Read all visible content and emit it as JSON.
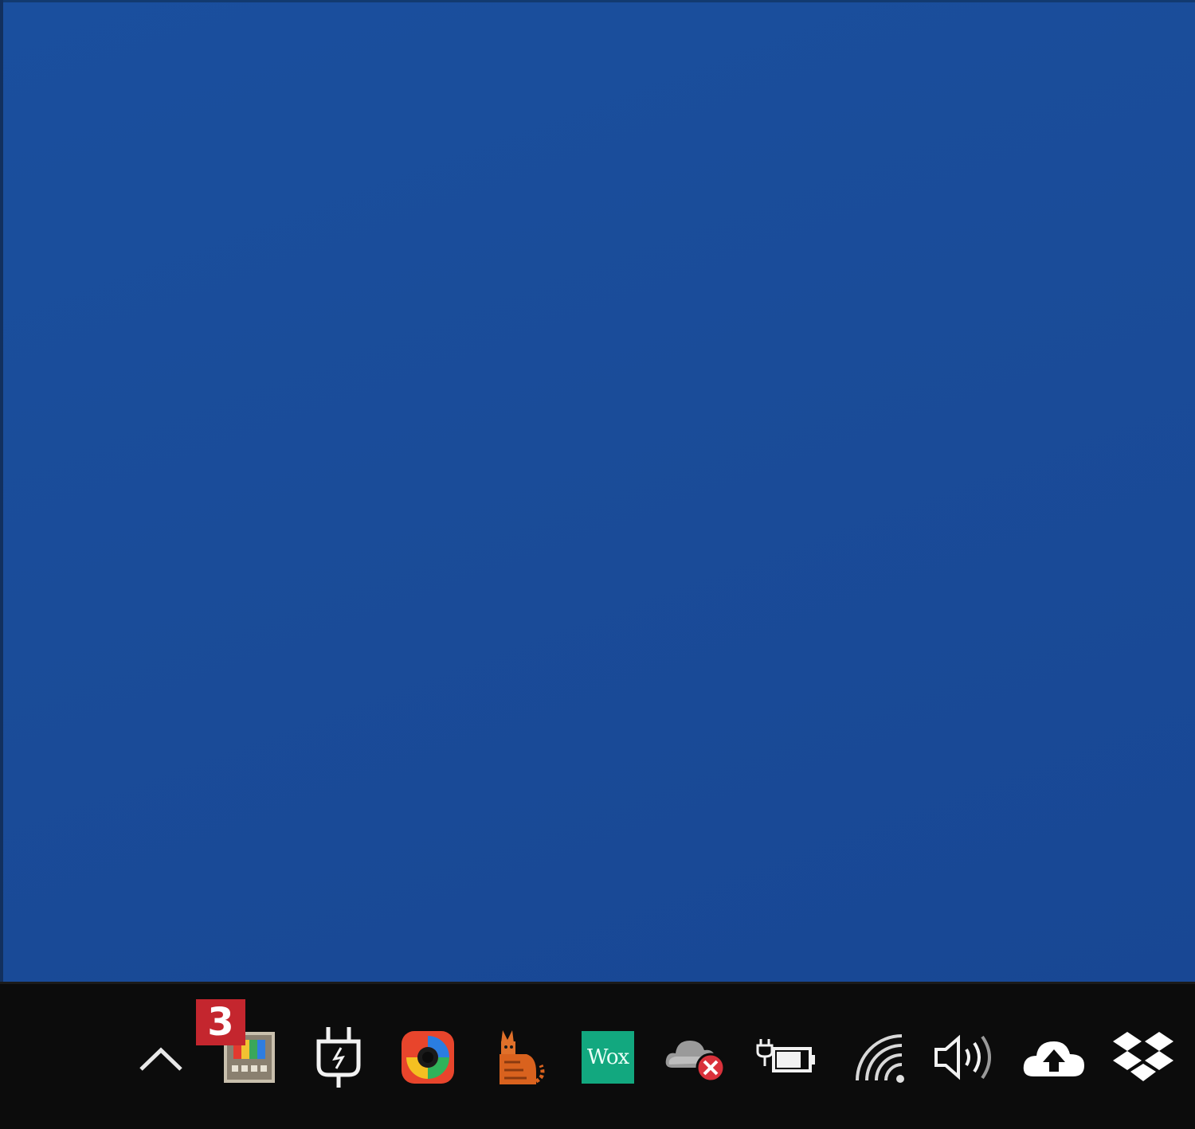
{
  "desktop": {
    "background_color": "#1a4c99"
  },
  "taskbar": {
    "background_color": "#0c0c0c",
    "tray_icons": [
      {
        "name": "show-hidden-icons",
        "icon": "chevron-up-icon"
      },
      {
        "name": "calendar-app",
        "icon": "colorful-calendar-icon",
        "badge": "3"
      },
      {
        "name": "power-plug",
        "icon": "power-plug-icon"
      },
      {
        "name": "colorful-ring-app",
        "icon": "colorful-ring-icon"
      },
      {
        "name": "cat-app",
        "icon": "cat-icon"
      },
      {
        "name": "wox-launcher",
        "icon": "wox-icon",
        "label": "Wox"
      },
      {
        "name": "onedrive-error",
        "icon": "cloud-error-icon"
      },
      {
        "name": "battery-charging",
        "icon": "battery-plug-icon"
      },
      {
        "name": "wifi",
        "icon": "wifi-icon"
      },
      {
        "name": "volume",
        "icon": "speaker-icon"
      },
      {
        "name": "cloud-upload",
        "icon": "cloud-upload-icon"
      },
      {
        "name": "dropbox",
        "icon": "dropbox-icon"
      }
    ]
  },
  "colors": {
    "badge": "#c4262e",
    "wox": "#12a87f",
    "error": "#d9313b"
  }
}
